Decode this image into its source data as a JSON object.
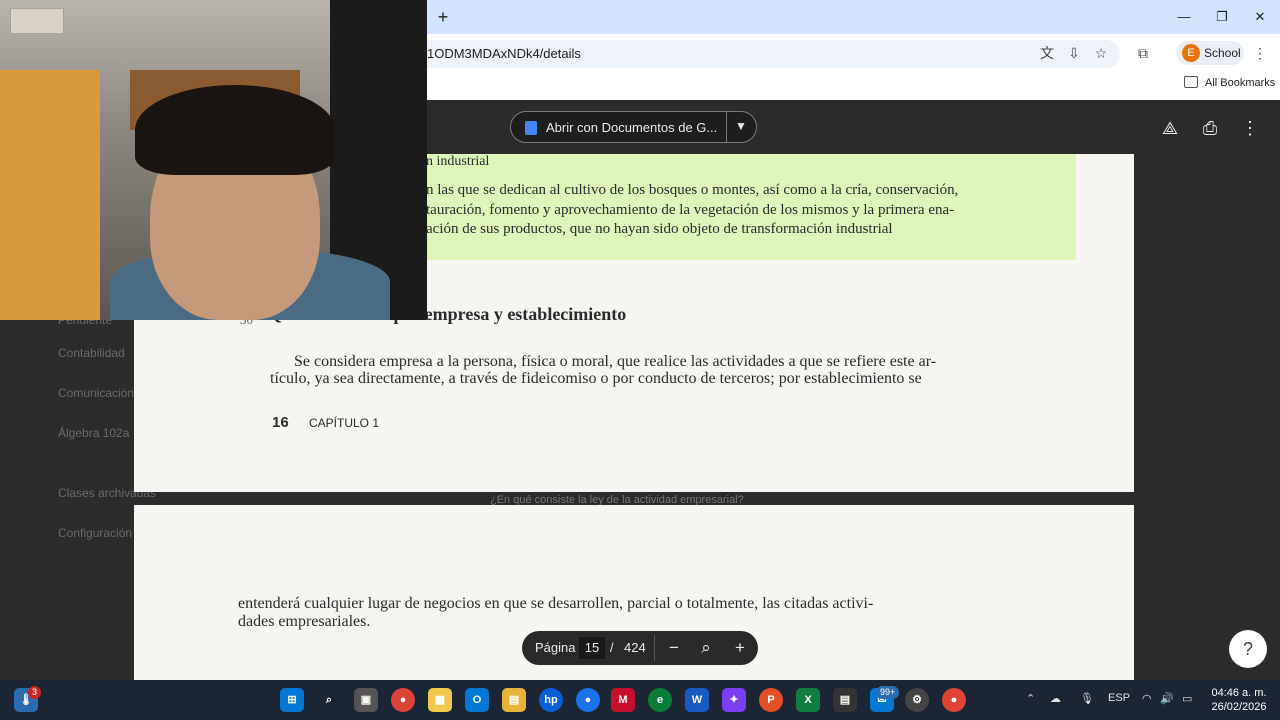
{
  "browser": {
    "url": "1ODM3MDAxNDk4/details",
    "profile_initial": "E",
    "profile_label": "School",
    "bookmarks_label": "All Bookmarks",
    "new_tab": "+",
    "window_controls": [
      "—",
      "❐",
      "✕"
    ]
  },
  "viewer": {
    "open_with_label": "Abrir con Documentos de G...",
    "page_label": "Página",
    "current_page": "15",
    "separator": "/",
    "total_pages": "424",
    "caption": "¿En qué consiste la ley de la actividad empresarial?"
  },
  "background_sidebar": [
    "Pendiente",
    "Contabilidad",
    "Comunicación",
    "Álgebra 102a",
    "Clases archivadas",
    "Configuración"
  ],
  "document": {
    "page1": {
      "highlight_heading": "n industrial",
      "highlight_lines": [
        "n las que se dedican al cultivo de los bosques o montes, así como a la cría, conservación,",
        "tauración, fomento y aprovechamiento de la vegetación de los mismos y la primera ena-",
        "ación de sus productos, que no hayan sido objeto de transformación industrial"
      ],
      "section_number": "30",
      "section_title": "Que se entiende por empresa y establecimiento",
      "body_lines": [
        "Se considera empresa a la persona, física o moral, que realice las actividades a que se refiere este ar-",
        "tículo, ya sea directamente, a través de fideicomiso o por conducto de terceros; por establecimiento se"
      ],
      "page_number": "16",
      "chapter": "CAPÍTULO 1"
    },
    "page2": {
      "body_lines": [
        "entenderá cualquier lugar de negocios en que se desarrollen, parcial o totalmente, las citadas activi-",
        "dades empresariales."
      ]
    }
  },
  "taskbar": {
    "language": "ESP",
    "time": "04:46 a. m.",
    "date": "26/02/2026",
    "badge_count": "99+",
    "notification_count": "3"
  }
}
